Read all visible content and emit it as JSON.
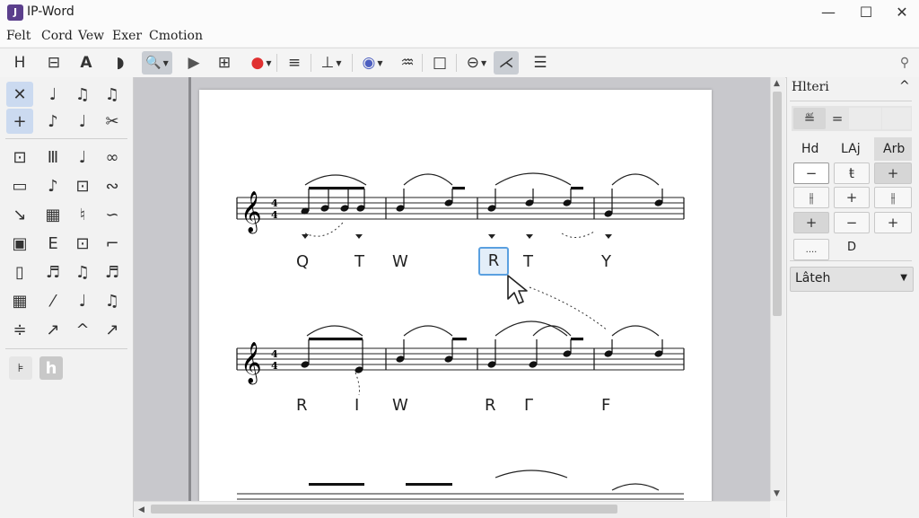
{
  "window": {
    "app_icon_glyph": "J",
    "title": "IP-Word",
    "minimize_glyph": "—",
    "maximize_glyph": "☐",
    "close_glyph": "✕"
  },
  "menu": [
    "Felt",
    "Cord",
    "Vew",
    "Exer",
    "Cmotion"
  ],
  "toolbar": {
    "items": [
      {
        "glyph": "H",
        "icon": "heading-icon"
      },
      {
        "glyph": "⊟",
        "icon": "frame-icon"
      },
      {
        "glyph": "A",
        "icon": "text-icon"
      },
      {
        "glyph": "◗",
        "icon": "shape-icon"
      },
      {
        "glyph": "🔍",
        "icon": "zoom-icon"
      },
      {
        "glyph": "▶",
        "icon": "play-icon"
      },
      {
        "glyph": "⊞",
        "icon": "grid-icon"
      },
      {
        "glyph": "●",
        "icon": "record-icon"
      },
      {
        "glyph": "≡",
        "icon": "align-icon"
      },
      {
        "glyph": "⊥",
        "icon": "spacing-icon"
      },
      {
        "glyph": "◉",
        "icon": "color-icon"
      },
      {
        "glyph": "♒",
        "icon": "wave-icon"
      },
      {
        "glyph": "□",
        "icon": "box-icon"
      },
      {
        "glyph": "⊖",
        "icon": "target-icon"
      },
      {
        "glyph": "⋌",
        "icon": "cursor-mode-icon"
      },
      {
        "glyph": "☰",
        "icon": "list-icon"
      },
      {
        "glyph": "⚲",
        "icon": "pin-icon"
      }
    ]
  },
  "palette": {
    "rows": [
      [
        "✕",
        "♩",
        "♫",
        "♫"
      ],
      [
        "+",
        "♪",
        "♩",
        "✂"
      ],
      [
        "⊡",
        "Ⅲ",
        "♩",
        "∞"
      ],
      [
        "▭",
        "♪",
        "⊡",
        "∾"
      ],
      [
        "↘",
        "▦",
        "♮",
        "∽"
      ],
      [
        "▣",
        "Ε",
        "⊡",
        "⌐"
      ],
      [
        "▯",
        "♬",
        "♫",
        "♬"
      ],
      [
        "▦",
        "⁄",
        "♩",
        "♫"
      ],
      [
        "≑",
        "↗",
        "^",
        "↗"
      ]
    ],
    "extra": [
      "⊧",
      "h"
    ],
    "accent_selected": "#cbdaf0"
  },
  "score": {
    "time_signature": [
      "4",
      "4"
    ],
    "clef": "𝄞",
    "system1_lyrics": [
      "Q",
      "T",
      "W",
      "R",
      "T",
      "Y"
    ],
    "system2_lyrics": [
      "R",
      "I",
      "W",
      "R",
      "Γ",
      "F"
    ],
    "selected_lyric": "R"
  },
  "panel": {
    "title": "Hlteri",
    "collapse_glyph": "^",
    "top_buttons": [
      "≝",
      "="
    ],
    "tabs": [
      "Hd",
      "LAj",
      "Arb"
    ],
    "grid": [
      [
        "−",
        "ŧ",
        "+"
      ],
      [
        "⫲",
        "+",
        "⫲"
      ],
      [
        "+",
        "−",
        "+"
      ]
    ],
    "small": [
      "....",
      "D"
    ],
    "dropdown_value": "Lâteh"
  }
}
